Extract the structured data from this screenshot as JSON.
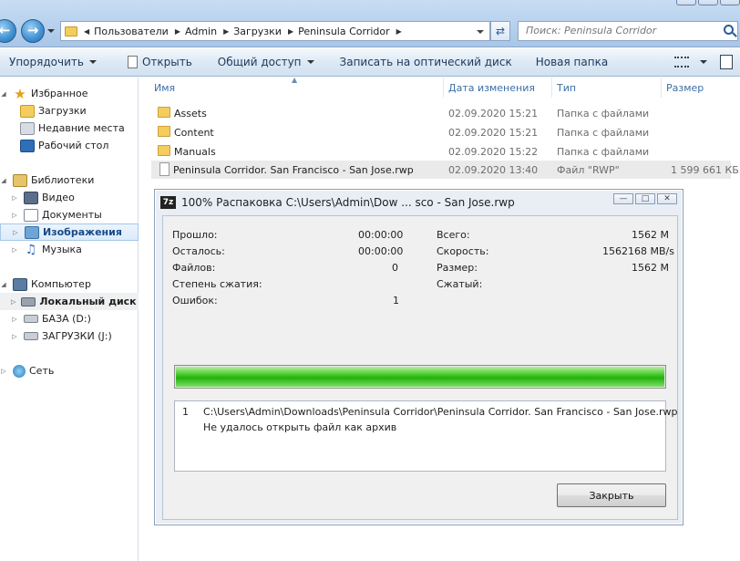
{
  "address": {
    "breadcrumbs": [
      "Пользователи",
      "Admin",
      "Загрузки",
      "Peninsula Corridor"
    ],
    "search_placeholder": "Поиск: Peninsula Corridor"
  },
  "toolbar": {
    "organize": "Упорядочить",
    "open": "Открыть",
    "share": "Общий доступ",
    "burn": "Записать на оптический диск",
    "new_folder": "Новая папка"
  },
  "nav": {
    "favorites": "Избранное",
    "downloads": "Загрузки",
    "recent": "Недавние места",
    "desktop": "Рабочий стол",
    "libraries": "Библиотеки",
    "video": "Видео",
    "documents": "Документы",
    "images": "Изображения",
    "music": "Музыка",
    "computer": "Компьютер",
    "local_disk": "Локальный диск (",
    "drive_d": "БАЗА (D:)",
    "drive_j": "ЗАГРУЗКИ (J:)",
    "network": "Сеть"
  },
  "columns": {
    "name": "Имя",
    "date": "Дата изменения",
    "type": "Тип",
    "size": "Размер"
  },
  "files": [
    {
      "name": "Assets",
      "date": "02.09.2020 15:21",
      "type": "Папка с файлами",
      "size": ""
    },
    {
      "name": "Content",
      "date": "02.09.2020 15:21",
      "type": "Папка с файлами",
      "size": ""
    },
    {
      "name": "Manuals",
      "date": "02.09.2020 15:22",
      "type": "Папка с файлами",
      "size": ""
    },
    {
      "name": "Peninsula Corridor. San Francisco - San Jose.rwp",
      "date": "02.09.2020 13:40",
      "type": "Файл \"RWP\"",
      "size": "1 599 661 КБ"
    }
  ],
  "dialog": {
    "logo": "7z",
    "title": "100% Распаковка C:\\Users\\Admin\\Dow ... sco - San Jose.rwp",
    "progress_fraction": 1.0,
    "labels": {
      "elapsed": "Прошло:",
      "remaining": "Осталось:",
      "files": "Файлов:",
      "ratio": "Степень сжатия:",
      "errors": "Ошибок:",
      "total": "Всего:",
      "speed": "Скорость:",
      "size": "Размер:",
      "packed": "Сжатый:"
    },
    "values": {
      "elapsed": "00:00:00",
      "remaining": "00:00:00",
      "files": "0",
      "errors": "1",
      "total": "1562 M",
      "speed": "1562168 MB/s",
      "size": "1562 M"
    },
    "message": {
      "index": "1",
      "path": "C:\\Users\\Admin\\Downloads\\Peninsula Corridor\\Peninsula Corridor. San Francisco - San Jose.rwp",
      "text": "Не удалось открыть файл как архив"
    },
    "close_label": "Закрыть"
  }
}
